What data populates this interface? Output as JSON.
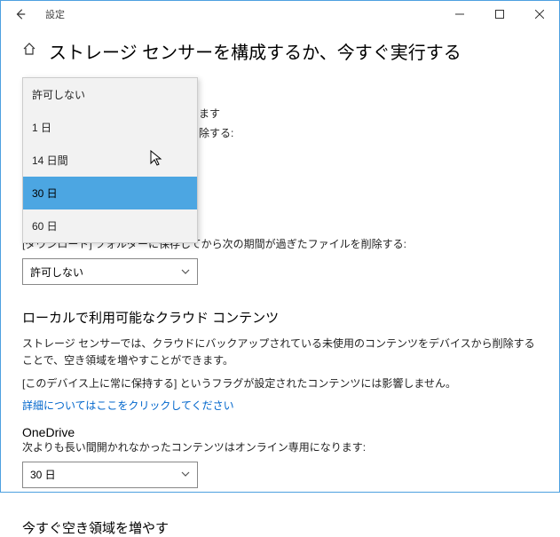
{
  "window": {
    "title": "設定"
  },
  "page": {
    "title": "ストレージ センサーを構成するか、今すぐ実行する"
  },
  "partial": {
    "line1": "余します",
    "line2": "を削除する:"
  },
  "dropdown": {
    "options": [
      "許可しない",
      "1 日",
      "14 日間",
      "30 日",
      "60 日"
    ],
    "selected_index": 3
  },
  "downloads": {
    "label": "[ダウンロード] フォルダーに保存してから次の期間が過ぎたファイルを削除する:",
    "combo_value": "許可しない"
  },
  "cloud": {
    "heading": "ローカルで利用可能なクラウド コンテンツ",
    "desc": "ストレージ センサーでは、クラウドにバックアップされている未使用のコンテンツをデバイスから削除することで、空き領域を増やすことができます。",
    "note": "[このデバイス上に常に保持する] というフラグが設定されたコンテンツには影響しません。",
    "link": "詳細についてはここをクリックしてください"
  },
  "onedrive": {
    "heading": "OneDrive",
    "desc": "次よりも長い間開かれなかったコンテンツはオンライン専用になります:",
    "combo_value": "30 日"
  },
  "freeup": {
    "heading": "今すぐ空き領域を増やす"
  }
}
